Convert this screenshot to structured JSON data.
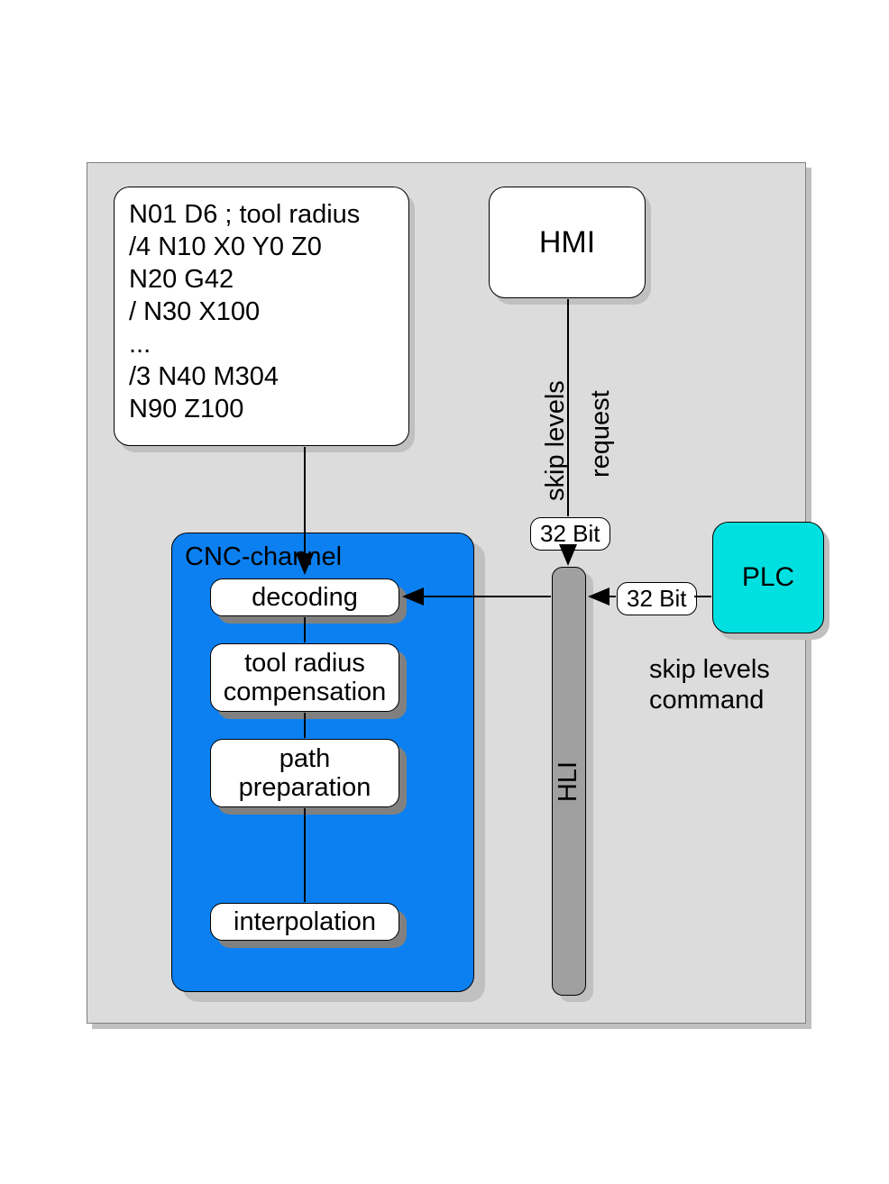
{
  "code": {
    "lines": [
      "N01 D6 ; tool radius",
      "/4 N10 X0 Y0 Z0",
      "N20 G42",
      "/ N30 X100",
      "...",
      "/3 N40 M304",
      "N90 Z100"
    ]
  },
  "hmi": {
    "label": "HMI"
  },
  "plc": {
    "label": "PLC"
  },
  "cnc": {
    "title": "CNC-channel",
    "stages": {
      "decoding": "decoding",
      "tool_radius": "tool radius\ncompensation",
      "path_prep": "path\npreparation",
      "interpolation": "interpolation"
    }
  },
  "hli": {
    "label": "HLI"
  },
  "arrows": {
    "hmi_to_hli": {
      "bit_label": "32 Bit",
      "vtext_left": "skip levels",
      "vtext_right": "request"
    },
    "plc_to_hli": {
      "bit_label": "32 Bit",
      "caption_line1": "skip levels",
      "caption_line2": "command"
    }
  }
}
